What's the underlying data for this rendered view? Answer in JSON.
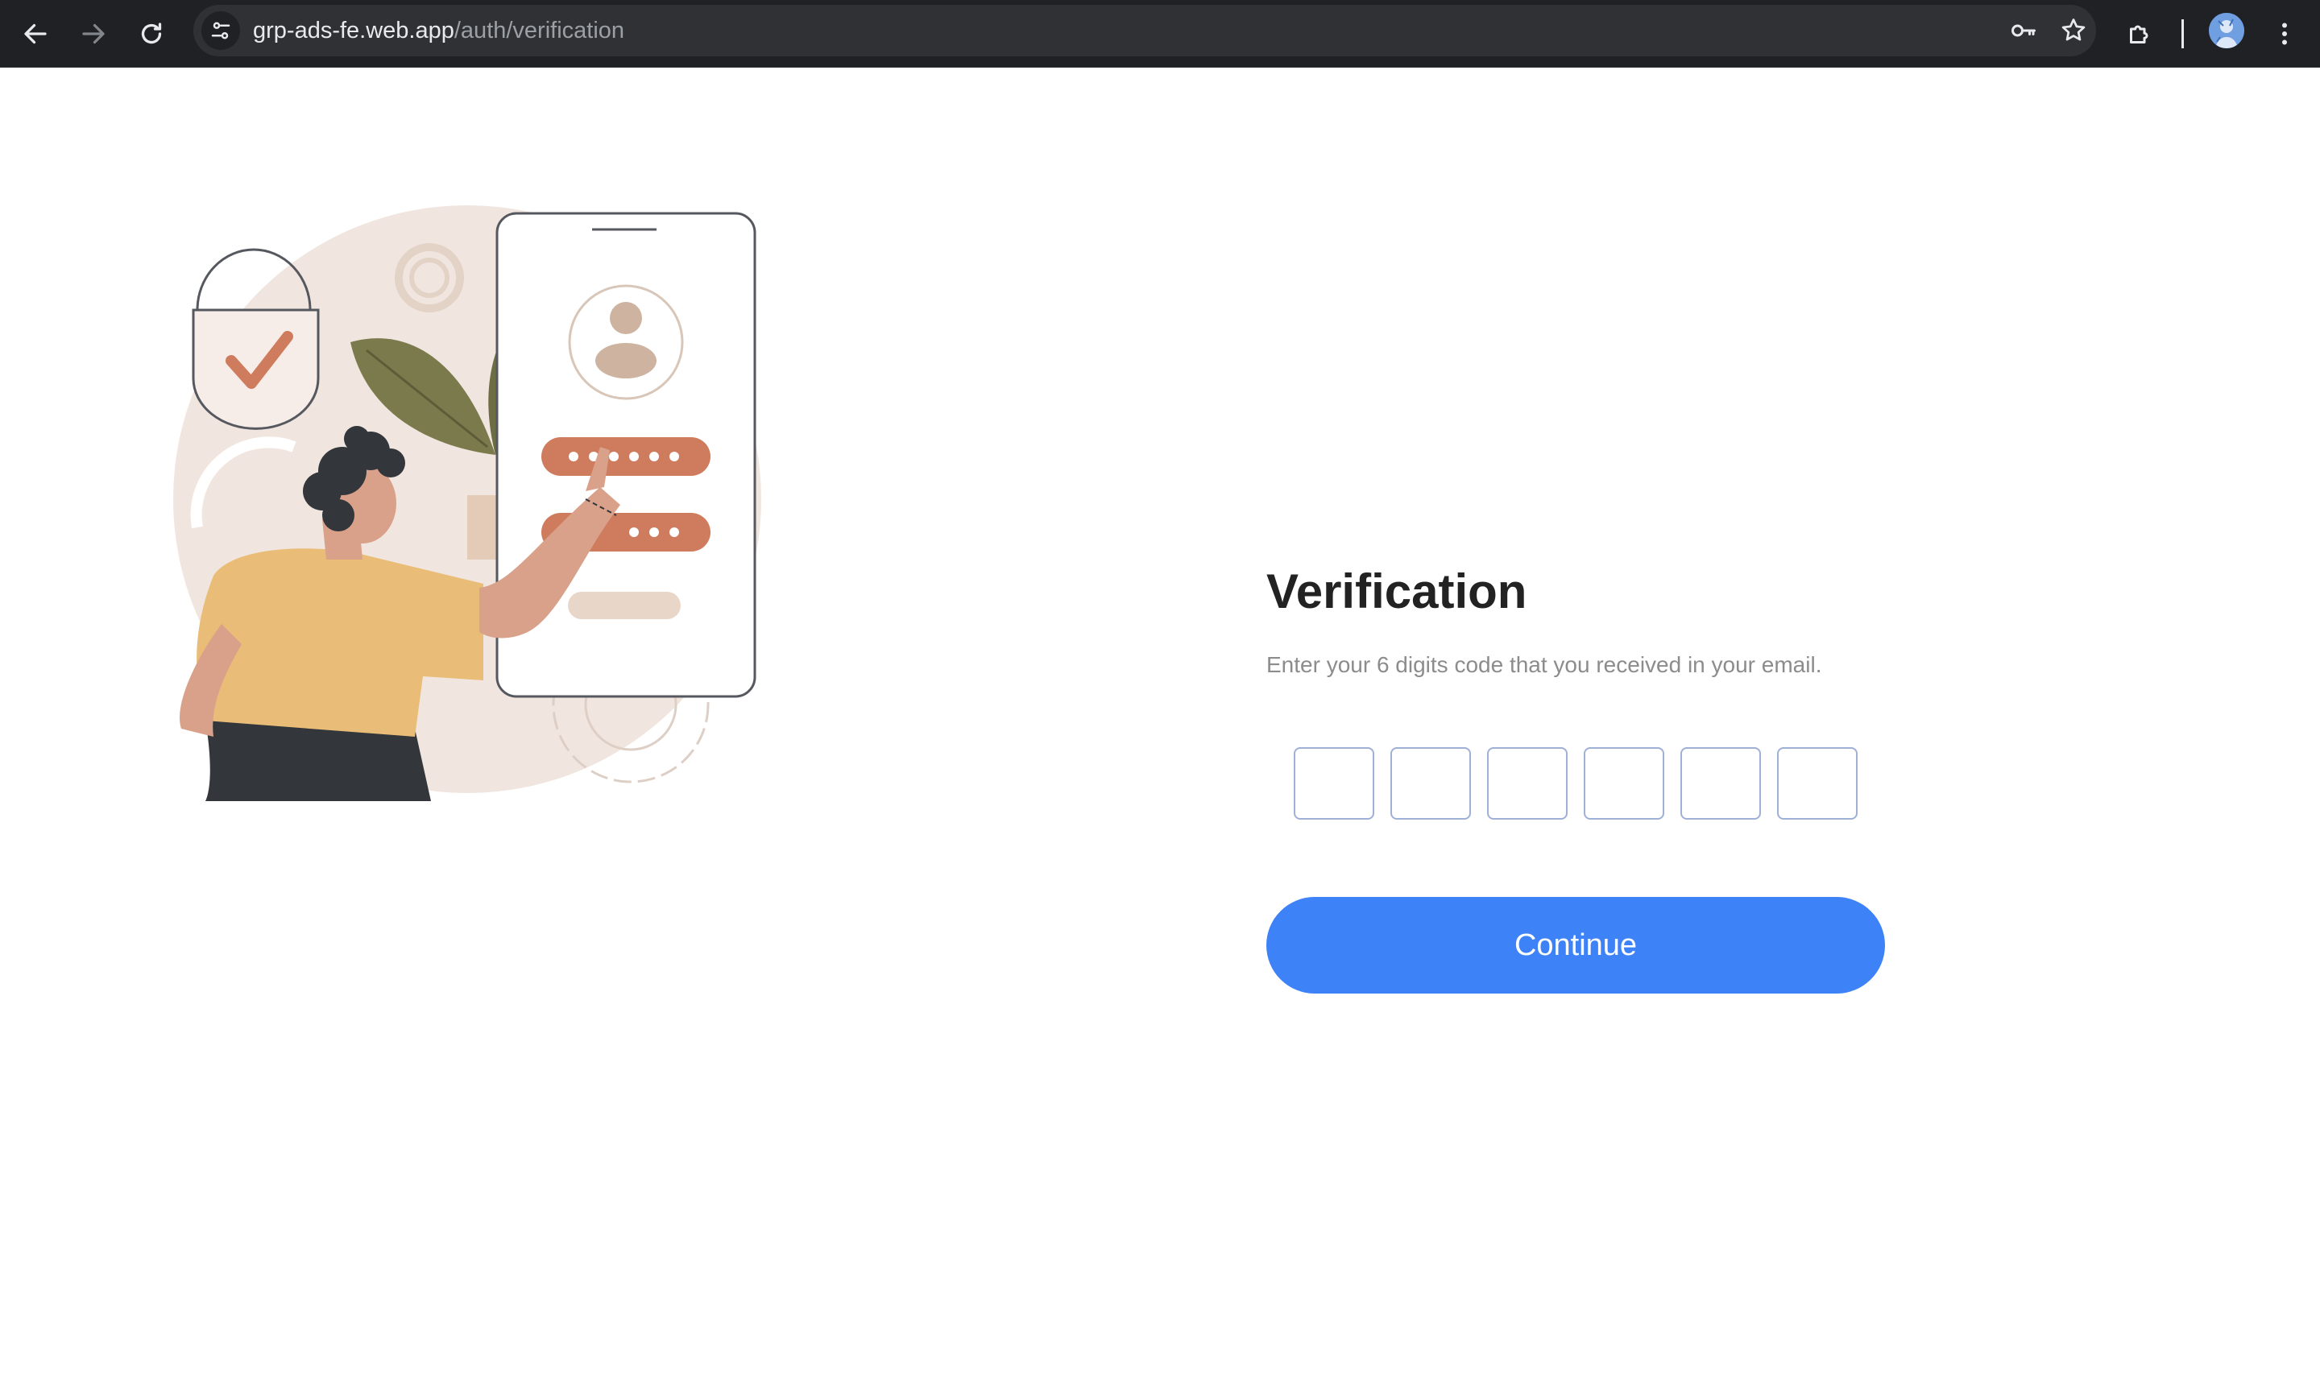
{
  "browser": {
    "url_host": "grp-ads-fe.web.app",
    "url_path": "/auth/verification",
    "icons": {
      "back": "arrow-left-icon",
      "forward": "arrow-right-icon",
      "reload": "reload-icon",
      "site_info": "tune-icon",
      "passwords": "key-icon",
      "bookmark": "star-icon",
      "extensions": "puzzle-icon",
      "profile": "avatar",
      "menu": "kebab-menu-icon"
    },
    "colors": {
      "toolbar": "#202124",
      "omnibox": "#303134"
    }
  },
  "verification": {
    "title": "Verification",
    "subtitle": "Enter your 6 digits code that you received in your email.",
    "code_boxes": [
      "",
      "",
      "",
      "",
      "",
      ""
    ],
    "continue_label": "Continue",
    "colors": {
      "accent": "#3e82f7",
      "box_border": "#9fb0d6",
      "title": "#222222",
      "subtitle": "#8c8c8c"
    }
  },
  "illustration": {
    "icon": "verification-illustration",
    "colors": {
      "blush": "#f1e6df",
      "terracotta": "#cf7b5d",
      "olive": "#7b7a4c",
      "mustard": "#e9bd77",
      "skin": "#d9a08a",
      "dark": "#33363b"
    }
  }
}
